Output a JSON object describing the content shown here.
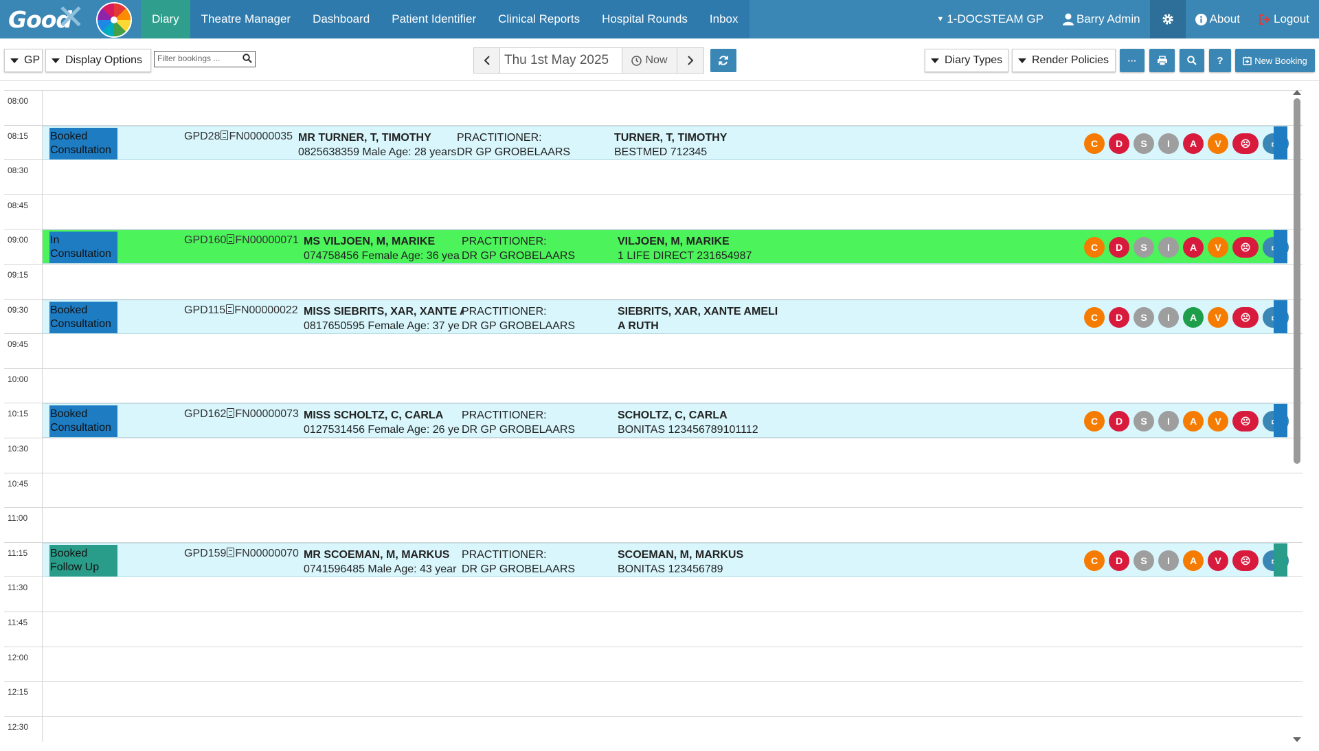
{
  "app": {
    "logo_text": "Good",
    "nav": [
      "Diary",
      "Theatre Manager",
      "Dashboard",
      "Patient Identifier",
      "Clinical Reports",
      "Hospital Rounds",
      "Inbox"
    ],
    "practice": "1-DOCSTEAM GP",
    "user": "Barry Admin",
    "about": "About",
    "logout": "Logout"
  },
  "toolbar": {
    "gp": "GP",
    "display_options": "Display Options",
    "filter_placeholder": "Filter bookings ...",
    "date": "Thu 1st May 2025",
    "now": "Now",
    "diary_types": "Diary Types",
    "render_policies": "Render Policies",
    "more": "···",
    "help": "?",
    "new_booking": "New Booking"
  },
  "times": [
    "08:00",
    "08:15",
    "08:30",
    "08:45",
    "09:00",
    "09:15",
    "09:30",
    "09:45",
    "10:00",
    "10:15",
    "10:30",
    "10:45",
    "11:00",
    "11:15",
    "11:30",
    "11:45",
    "12:00",
    "12:15",
    "12:30"
  ],
  "bookings": [
    {
      "status": "Booked Consultation",
      "code": "GPD28",
      "file": "FN00000035",
      "name": "MR TURNER, T, TIMOTHY",
      "details": "0825638359 Male Age: 28 years",
      "prac_label": "PRACTITIONER:",
      "prac_name": "DR GP GROBELAARS",
      "bill_name": "TURNER, T, TIMOTHY",
      "bill_detail": "BESTMED 712345",
      "badges": [
        "C",
        "D",
        "S",
        "I",
        "A",
        "V",
        "☹",
        "▭"
      ]
    },
    {
      "status": "In Consultation",
      "code": "GPD160",
      "file": "FN00000071",
      "name": "MS VILJOEN, M, MARIKE",
      "details": "074758456 Female Age: 36 yea",
      "prac_label": "PRACTITIONER:",
      "prac_name": "DR GP GROBELAARS",
      "bill_name": "VILJOEN, M, MARIKE",
      "bill_detail": "1 LIFE DIRECT 231654987",
      "badges": [
        "C",
        "D",
        "S",
        "I",
        "A",
        "V",
        "☹",
        "▭"
      ]
    },
    {
      "status": "Booked Consultation",
      "code": "GPD115",
      "file": "FN00000022",
      "name": "MISS SIEBRITS, XAR, XANTE A",
      "details": "0817650595 Female Age: 37 ye",
      "prac_label": "PRACTITIONER:",
      "prac_name": "DR GP GROBELAARS",
      "bill_name": "SIEBRITS, XAR, XANTE AMELI",
      "bill_detail": "A RUTH",
      "badges": [
        "C",
        "D",
        "S",
        "I",
        "A",
        "V",
        "☹",
        "▭"
      ]
    },
    {
      "status": "Booked Consultation",
      "code": "GPD162",
      "file": "FN00000073",
      "name": "MISS SCHOLTZ, C, CARLA",
      "details": "0127531456 Female Age: 26 ye",
      "prac_label": "PRACTITIONER:",
      "prac_name": "DR GP GROBELAARS",
      "bill_name": "SCHOLTZ, C, CARLA",
      "bill_detail": "BONITAS 123456789101112",
      "badges": [
        "C",
        "D",
        "S",
        "I",
        "A",
        "V",
        "☹",
        "▭"
      ]
    },
    {
      "status": "Booked Follow Up",
      "code": "GPD159",
      "file": "FN00000070",
      "name": "MR SCOEMAN, M, MARKUS",
      "details": "0741596485 Male Age: 43 year",
      "prac_label": "PRACTITIONER:",
      "prac_name": "DR GP GROBELAARS",
      "bill_name": "SCOEMAN, M, MARKUS",
      "bill_detail": "BONITAS 123456789",
      "badges": [
        "C",
        "D",
        "S",
        "I",
        "A",
        "V",
        "☹",
        "▭"
      ]
    }
  ],
  "colors": {
    "nav": "#3a86b4",
    "active_tab": "#2f9e8c",
    "booked": "#1e7cc2",
    "follow_up": "#2a9d8a",
    "in_consult_row": "#4cf35a",
    "row": "#d8f6fc",
    "badge_orange": "#f57c00",
    "badge_red": "#d81b3c",
    "badge_grey": "#9e9e9e",
    "badge_green": "#1e9e4a",
    "badge_blue": "#3a86b4"
  }
}
